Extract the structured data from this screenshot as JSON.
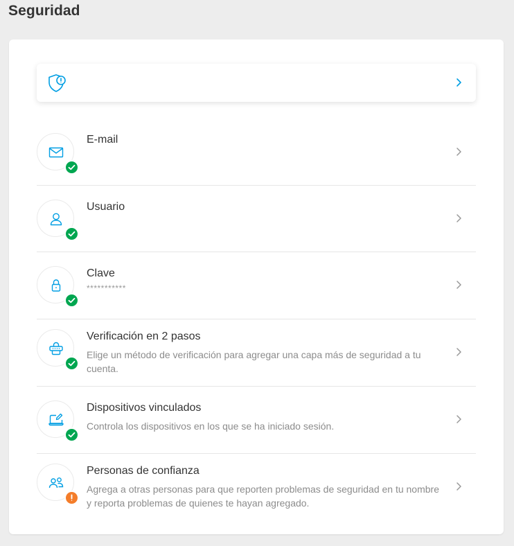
{
  "page": {
    "title": "Seguridad"
  },
  "colors": {
    "accent": "#009ee3",
    "ok": "#00a650",
    "warn": "#f47d2a"
  },
  "alert": {
    "icon": "shield-alert-icon"
  },
  "items": [
    {
      "title": "E-mail",
      "subtitle": "",
      "icon": "mail-icon",
      "status": "ok"
    },
    {
      "title": "Usuario",
      "subtitle": "",
      "icon": "user-icon",
      "status": "ok"
    },
    {
      "title": "Clave",
      "subtitle": "***********",
      "icon": "lock-icon",
      "status": "ok"
    },
    {
      "title": "Verificación en 2 pasos",
      "subtitle": "Elige un método de verificación para agregar una capa más de seguridad a tu cuenta.",
      "icon": "two-step-icon",
      "status": "ok"
    },
    {
      "title": "Dispositivos vinculados",
      "subtitle": "Controla los dispositivos en los que se ha iniciado sesión.",
      "icon": "devices-icon",
      "status": "ok"
    },
    {
      "title": "Personas de confianza",
      "subtitle": "Agrega a otras personas para que reporten problemas de seguridad en tu nombre y reporta problemas de quienes te hayan agregado.",
      "icon": "people-icon",
      "status": "warn"
    }
  ]
}
